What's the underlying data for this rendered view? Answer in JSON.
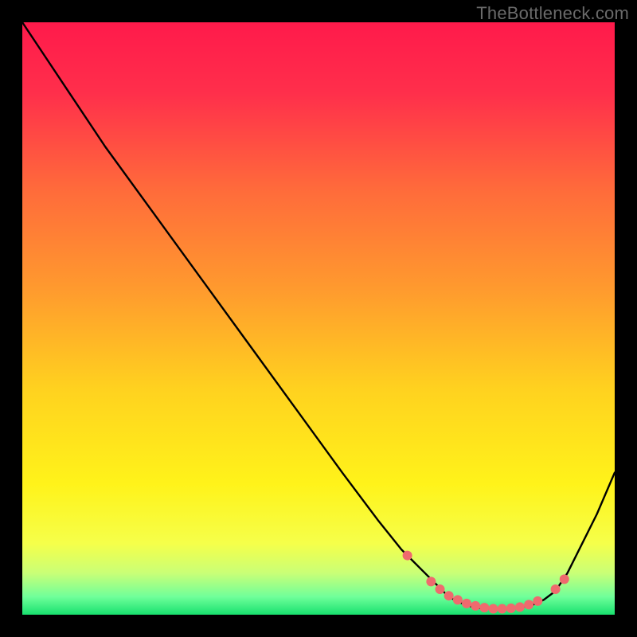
{
  "watermark": "TheBottleneck.com",
  "chart_data": {
    "type": "line",
    "title": "",
    "xlabel": "",
    "ylabel": "",
    "xlim": [
      0,
      100
    ],
    "ylim": [
      0,
      100
    ],
    "grid": false,
    "legend": false,
    "background": {
      "type": "vertical_gradient",
      "stops": [
        {
          "offset": 0.0,
          "color": "#ff1a4b"
        },
        {
          "offset": 0.12,
          "color": "#ff2f4b"
        },
        {
          "offset": 0.28,
          "color": "#ff6a3b"
        },
        {
          "offset": 0.45,
          "color": "#ff9a2e"
        },
        {
          "offset": 0.62,
          "color": "#ffd21f"
        },
        {
          "offset": 0.78,
          "color": "#fff31a"
        },
        {
          "offset": 0.88,
          "color": "#f5ff4a"
        },
        {
          "offset": 0.93,
          "color": "#c9ff77"
        },
        {
          "offset": 0.97,
          "color": "#6fff9a"
        },
        {
          "offset": 1.0,
          "color": "#18e06e"
        }
      ]
    },
    "series": [
      {
        "name": "curve",
        "type": "line",
        "color": "#000000",
        "x": [
          0,
          4,
          8,
          14,
          22,
          30,
          38,
          46,
          54,
          60,
          64,
          68,
          70,
          72,
          74,
          76,
          78,
          80,
          82,
          84,
          86,
          88,
          90,
          92,
          94,
          97,
          100
        ],
        "y": [
          100,
          94,
          88,
          79,
          68,
          57,
          46,
          35,
          24,
          16,
          11,
          7,
          5,
          3,
          2,
          1.3,
          1,
          1,
          1,
          1.2,
          1.6,
          2.5,
          4,
          7,
          11,
          17,
          24
        ]
      },
      {
        "name": "markers",
        "type": "scatter",
        "color": "#ef6a6e",
        "x": [
          65,
          69,
          70.5,
          72,
          73.5,
          75,
          76.5,
          78,
          79.5,
          81,
          82.5,
          84,
          85.5,
          87,
          90,
          91.5
        ],
        "y": [
          10,
          5.6,
          4.3,
          3.2,
          2.5,
          1.9,
          1.5,
          1.2,
          1.0,
          1.0,
          1.1,
          1.3,
          1.7,
          2.3,
          4.3,
          6.0
        ]
      }
    ]
  }
}
